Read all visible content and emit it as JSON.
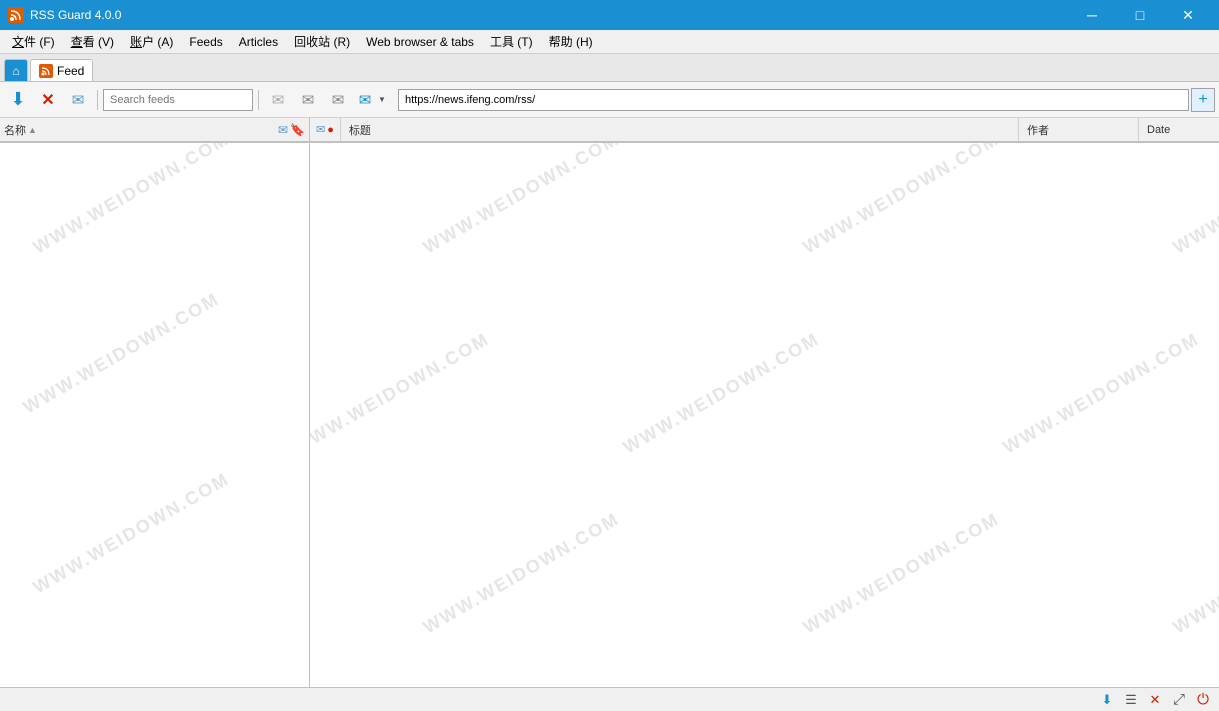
{
  "titlebar": {
    "app_title": "RSS Guard 4.0.0",
    "app_icon": "rss",
    "controls": {
      "minimize": "─",
      "maximize": "□",
      "close": "✕"
    }
  },
  "menubar": {
    "items": [
      {
        "label": "文件 (F)",
        "id": "file"
      },
      {
        "label": "查看 (V)",
        "id": "view"
      },
      {
        "label": "账户 (A)",
        "id": "account"
      },
      {
        "label": "Feeds",
        "id": "feeds"
      },
      {
        "label": "Articles",
        "id": "articles"
      },
      {
        "label": "回收站 (R)",
        "id": "recycle"
      },
      {
        "label": "Web browser & tabs",
        "id": "webbrowser"
      },
      {
        "label": "工具 (T)",
        "id": "tools"
      },
      {
        "label": "帮助 (H)",
        "id": "help"
      }
    ]
  },
  "tabs": [
    {
      "label": "Feed",
      "type": "rss",
      "active": true
    }
  ],
  "toolbar": {
    "buttons": [
      {
        "id": "update-all",
        "icon": "⬇",
        "color": "#1a8fd1",
        "tooltip": "Update all feeds"
      },
      {
        "id": "stop",
        "icon": "✕",
        "color": "#cc2200",
        "tooltip": "Stop"
      },
      {
        "id": "mark-read",
        "icon": "✉",
        "color": "#5599cc",
        "tooltip": "Mark as read"
      }
    ],
    "search_placeholder": "Search feeds",
    "article_buttons": [
      {
        "id": "msg-prev",
        "icon": "✉",
        "color": "#aaaaaa"
      },
      {
        "id": "msg-next",
        "icon": "✉",
        "color": "#888888"
      },
      {
        "id": "msg-important",
        "icon": "✉",
        "color": "#888888"
      }
    ],
    "url_value": "https://news.ifeng.com/rss/",
    "url_add_icon": "+"
  },
  "feeds_panel": {
    "col_name": "名称",
    "sort_indicator": "▲",
    "watermarks": [
      "WWW.WEIDOWN.COM",
      "WWW.WEIDOWN.COM",
      "WWW.WEIDOWN.COM"
    ]
  },
  "articles_panel": {
    "col_icons_unread": "✉",
    "col_icons_important": "🔴",
    "col_title": "标题",
    "col_author": "作者",
    "col_date": "Date",
    "watermarks": [
      "WWW.WEIDOWN.COM",
      "WWW.WEIDOWN.COM",
      "WWW.WEIDOWN.COM",
      "WWW.WEIDOWN.COM"
    ]
  },
  "statusbar": {
    "icons": [
      {
        "id": "download",
        "icon": "⬇",
        "color": "#1a8fd1"
      },
      {
        "id": "settings",
        "icon": "☰",
        "color": "#555"
      },
      {
        "id": "close",
        "icon": "✕",
        "color": "#cc2200"
      },
      {
        "id": "expand",
        "icon": "⤢",
        "color": "#555"
      },
      {
        "id": "power",
        "icon": "⏻",
        "color": "#cc2200"
      }
    ]
  }
}
